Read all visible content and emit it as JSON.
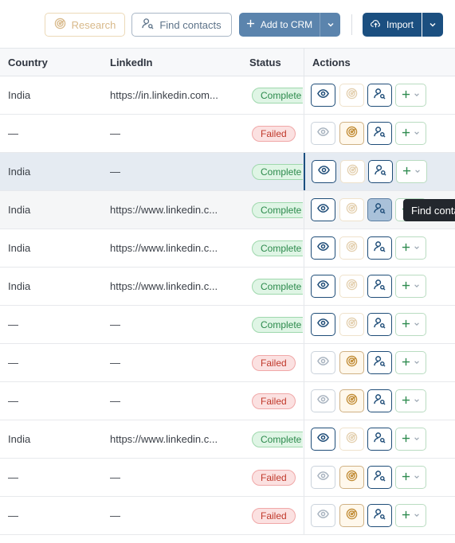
{
  "toolbar": {
    "research_label": "Research",
    "find_contacts_label": "Find contacts",
    "add_to_crm_label": "Add to CRM",
    "import_label": "Import"
  },
  "columns": {
    "country": "Country",
    "linkedin": "LinkedIn",
    "status": "Status",
    "actions": "Actions"
  },
  "rows": [
    {
      "country": "India",
      "linkedin": "https://in.linkedin.com...",
      "status": "Complete",
      "status_type": "ok",
      "research_on": false,
      "view_dim": false
    },
    {
      "country": "—",
      "linkedin": "—",
      "status": "Failed",
      "status_type": "fail",
      "research_on": true,
      "view_dim": true
    },
    {
      "country": "India",
      "linkedin": "—",
      "status": "Complete",
      "status_type": "ok",
      "research_on": false,
      "view_dim": false
    },
    {
      "country": "India",
      "linkedin": "https://www.linkedin.c...",
      "status": "Complete",
      "status_type": "ok",
      "research_on": false,
      "view_dim": false
    },
    {
      "country": "India",
      "linkedin": "https://www.linkedin.c...",
      "status": "Complete",
      "status_type": "ok",
      "research_on": false,
      "view_dim": false
    },
    {
      "country": "India",
      "linkedin": "https://www.linkedin.c...",
      "status": "Complete",
      "status_type": "ok",
      "research_on": false,
      "view_dim": false
    },
    {
      "country": "—",
      "linkedin": "—",
      "status": "Complete",
      "status_type": "ok",
      "research_on": false,
      "view_dim": false
    },
    {
      "country": "—",
      "linkedin": "—",
      "status": "Failed",
      "status_type": "fail",
      "research_on": true,
      "view_dim": true
    },
    {
      "country": "—",
      "linkedin": "—",
      "status": "Failed",
      "status_type": "fail",
      "research_on": true,
      "view_dim": true
    },
    {
      "country": "India",
      "linkedin": "https://www.linkedin.c...",
      "status": "Complete",
      "status_type": "ok",
      "research_on": false,
      "view_dim": false
    },
    {
      "country": "—",
      "linkedin": "—",
      "status": "Failed",
      "status_type": "fail",
      "research_on": true,
      "view_dim": true
    },
    {
      "country": "—",
      "linkedin": "—",
      "status": "Failed",
      "status_type": "fail",
      "research_on": true,
      "view_dim": true
    }
  ],
  "selected_row": 2,
  "hovered_row": 3,
  "tooltip": {
    "text": "Find contacts"
  },
  "icons": {
    "research": "research-radar-icon",
    "find": "find-contacts-icon",
    "view": "eye-icon",
    "add": "plus-icon",
    "caret": "chevron-down-icon",
    "import": "cloud-upload-icon"
  },
  "colors": {
    "primary": "#1b4f80",
    "crm": "#5b84ad",
    "complete": "#2c8a4c",
    "failed": "#c0392b",
    "research": "#c08a32"
  }
}
